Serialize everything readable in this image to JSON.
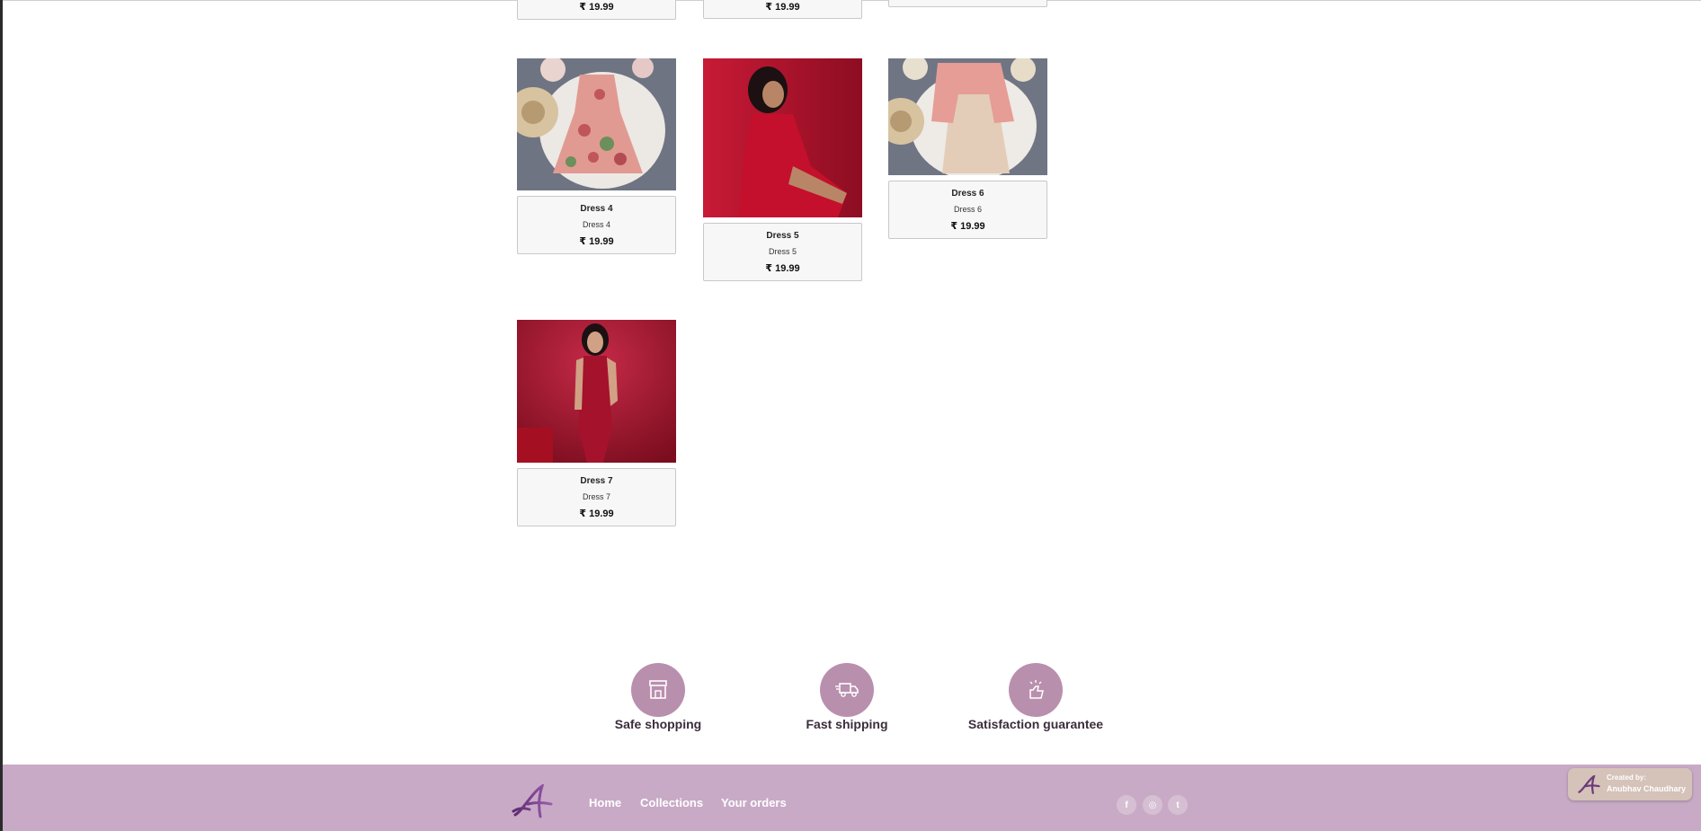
{
  "products_top_partial": [
    {
      "price": "₹ 19.99"
    },
    {
      "price": "₹ 19.99"
    },
    {
      "price": ""
    }
  ],
  "products": [
    {
      "title": "Dress 4",
      "subtitle": "Dress 4",
      "price": "₹ 19.99",
      "image": "floral pink strap dress on fur rug with hat"
    },
    {
      "title": "Dress 5",
      "subtitle": "Dress 5",
      "price": "₹ 19.99",
      "image": "woman in red halter dress on red background"
    },
    {
      "title": "Dress 6",
      "subtitle": "Dress 6",
      "price": "₹ 19.99",
      "image": "pink jacket over beige lace dress flat lay"
    },
    {
      "title": "Dress 7",
      "subtitle": "Dress 7",
      "price": "₹ 19.99",
      "image": "woman in red bodycon dress on red background"
    }
  ],
  "features": [
    {
      "label": "Safe shopping",
      "icon": "store-icon"
    },
    {
      "label": "Fast shipping",
      "icon": "delivery-truck-icon"
    },
    {
      "label": "Satisfaction guarantee",
      "icon": "thumbs-up-icon"
    }
  ],
  "footer": {
    "nav": {
      "home": "Home",
      "collections": "Collections",
      "orders": "Your orders"
    },
    "social": [
      {
        "name": "facebook-icon",
        "glyph": "f"
      },
      {
        "name": "instagram-icon",
        "glyph": "◎"
      },
      {
        "name": "twitter-icon",
        "glyph": "t"
      }
    ]
  },
  "credit": {
    "line1": "Created by:",
    "line2": "Anubhav Chaudhary"
  },
  "colors": {
    "accent": "#b98fae",
    "footer": "#c8aac6",
    "card_bg": "#f7f7f7"
  }
}
